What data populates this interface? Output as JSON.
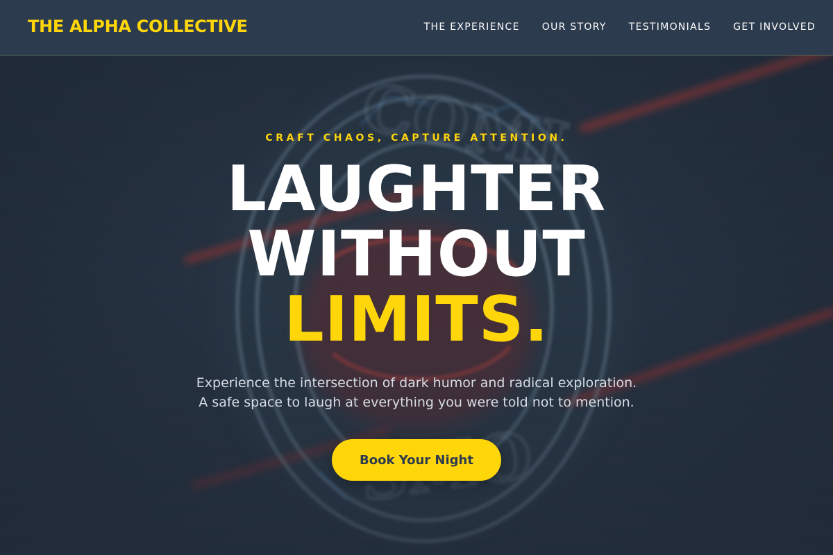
{
  "header": {
    "brand": "THE ALPHA COLLECTIVE",
    "nav": [
      {
        "label": "THE EXPERIENCE"
      },
      {
        "label": "OUR STORY"
      },
      {
        "label": "TESTIMONIALS"
      },
      {
        "label": "GET INVOLVED"
      }
    ]
  },
  "hero": {
    "tagline": "CRAFT CHAOS, CAPTURE ATTENTION.",
    "headline": {
      "line1": "LAUGHTER",
      "line2": "WITHOUT",
      "line3": "LIMITS."
    },
    "subtext": {
      "line1": "Experience the intersection of dark humor and radical exploration.",
      "line2": "A safe space to laugh at everything you were told not to mention."
    },
    "cta_label": "Book Your Night"
  },
  "colors": {
    "accent": "#ffd60a",
    "header_bg": "#2d3b4e",
    "hero_bg": "#263241",
    "text": "#ffffff"
  }
}
